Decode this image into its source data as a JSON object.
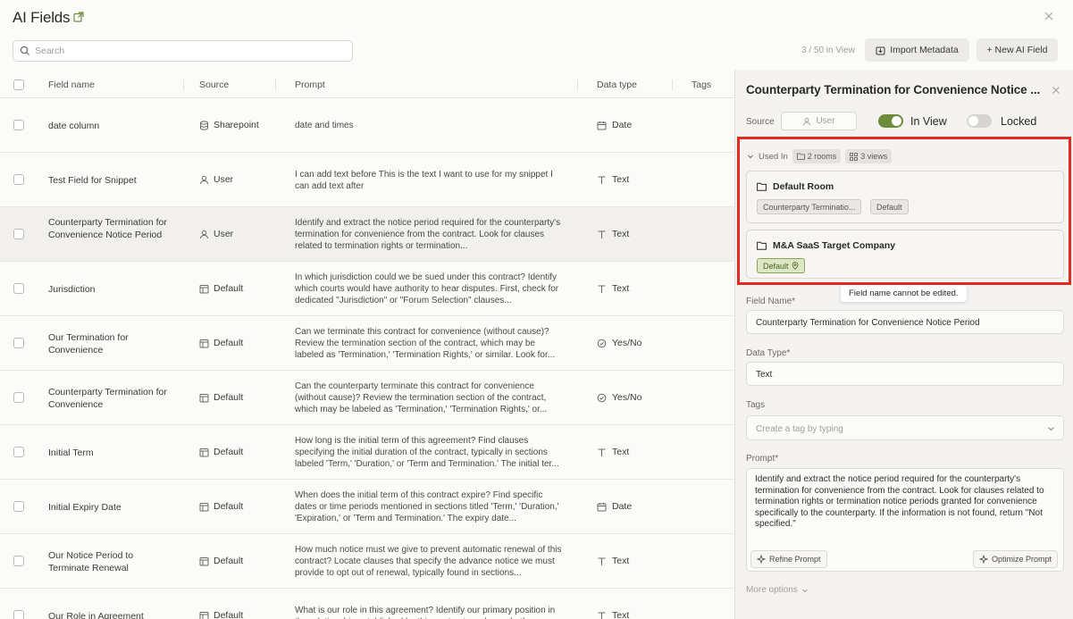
{
  "header": {
    "title": "AI Fields"
  },
  "search": {
    "placeholder": "Search"
  },
  "toolbar": {
    "view_count": "3 / 50 in View",
    "import_label": "Import Metadata",
    "new_label": "+ New AI Field"
  },
  "table": {
    "columns": {
      "name": "Field name",
      "source": "Source",
      "prompt": "Prompt",
      "type": "Data type",
      "tags": "Tags"
    },
    "rows": [
      {
        "name": "date column",
        "source": "Sharepoint",
        "source_icon": "database-icon",
        "prompt": "date and times",
        "type": "Date",
        "type_icon": "calendar-icon"
      },
      {
        "name": "Test Field for Snippet",
        "source": "User",
        "source_icon": "user-icon",
        "prompt": "I can add text before This is the text I want to use for my snippet I can add text after",
        "type": "Text",
        "type_icon": "text-icon"
      },
      {
        "name": "Counterparty Termination for Convenience Notice Period",
        "source": "User",
        "source_icon": "user-icon",
        "prompt": "Identify and extract the notice period required for the counterparty's termination for convenience from the contract. Look for clauses related to termination rights or termination...",
        "type": "Text",
        "type_icon": "text-icon"
      },
      {
        "name": "Jurisdiction",
        "source": "Default",
        "source_icon": "default-icon",
        "prompt": "In which jurisdiction could we be sued under this contract? Identify which courts would have authority to hear disputes. First, check for dedicated \"Jurisdiction\" or \"Forum Selection\" clauses...",
        "type": "Text",
        "type_icon": "text-icon"
      },
      {
        "name": "Our Termination for Convenience",
        "source": "Default",
        "source_icon": "default-icon",
        "prompt": "Can we terminate this contract for convenience (without cause)? Review the termination section of the contract, which may be labeled as 'Termination,' 'Termination Rights,' or similar. Look for...",
        "type": "Yes/No",
        "type_icon": "check-circle-icon"
      },
      {
        "name": "Counterparty Termination for Convenience",
        "source": "Default",
        "source_icon": "default-icon",
        "prompt": "Can the counterparty terminate this contract for convenience (without cause)? Review the termination section of the contract, which may be labeled as 'Termination,' 'Termination Rights,' or...",
        "type": "Yes/No",
        "type_icon": "check-circle-icon"
      },
      {
        "name": "Initial Term",
        "source": "Default",
        "source_icon": "default-icon",
        "prompt": "How long is the initial term of this agreement? Find clauses specifying the initial duration of the contract, typically in sections labeled 'Term,' 'Duration,' or 'Term and Termination.' The initial ter...",
        "type": "Text",
        "type_icon": "text-icon"
      },
      {
        "name": "Initial Expiry Date",
        "source": "Default",
        "source_icon": "default-icon",
        "prompt": "When does the initial term of this contract expire? Find specific dates or time periods mentioned in sections titled 'Term,' 'Duration,' 'Expiration,' or 'Term and Termination.' The expiry date...",
        "type": "Date",
        "type_icon": "calendar-icon"
      },
      {
        "name": "Our Notice Period to Terminate Renewal",
        "source": "Default",
        "source_icon": "default-icon",
        "prompt": "How much notice must we give to prevent automatic renewal of this contract? Locate clauses that specify the advance notice we must provide to opt out of renewal, typically found in sections...",
        "type": "Text",
        "type_icon": "text-icon"
      },
      {
        "name": "Our Role in Agreement",
        "source": "Default",
        "source_icon": "default-icon",
        "prompt": "What is our role in this agreement? Identify our primary position in the relationship established by this contract, such as whether we",
        "type": "Text",
        "type_icon": "text-icon"
      }
    ]
  },
  "panel": {
    "title": "Counterparty Termination for Convenience Notice ...",
    "source_label": "Source",
    "source_value": "User",
    "in_view_label": "In View",
    "locked_label": "Locked",
    "in_view_on": true,
    "locked_on": false,
    "used_in_label": "Used In",
    "rooms_chip": "2 rooms",
    "views_chip": "3 views",
    "rooms": [
      {
        "name": "Default Room",
        "tags": [
          "Counterparty Terminatio...",
          "Default"
        ]
      },
      {
        "name": "M&A SaaS Target Company",
        "tags": [
          "Default"
        ]
      }
    ],
    "tooltip": "Field name cannot be edited.",
    "field_name_label": "Field Name*",
    "field_name_value": "Counterparty Termination for Convenience Notice Period",
    "data_type_label": "Data Type*",
    "data_type_value": "Text",
    "tags_label": "Tags",
    "tags_placeholder": "Create a tag by typing",
    "prompt_label": "Prompt*",
    "prompt_value": "Identify and extract the notice period required for the counterparty's termination for convenience from the contract. Look for clauses related to termination rights or termination notice periods granted for convenience specifically to the counterparty. If the information is not found, return \"Not specified.\"",
    "refine_label": "Refine Prompt",
    "optimize_label": "Optimize Prompt",
    "more_options_label": "More options"
  },
  "colors": {
    "accent": "#6e8c3c",
    "highlight_border": "#e0291f"
  }
}
